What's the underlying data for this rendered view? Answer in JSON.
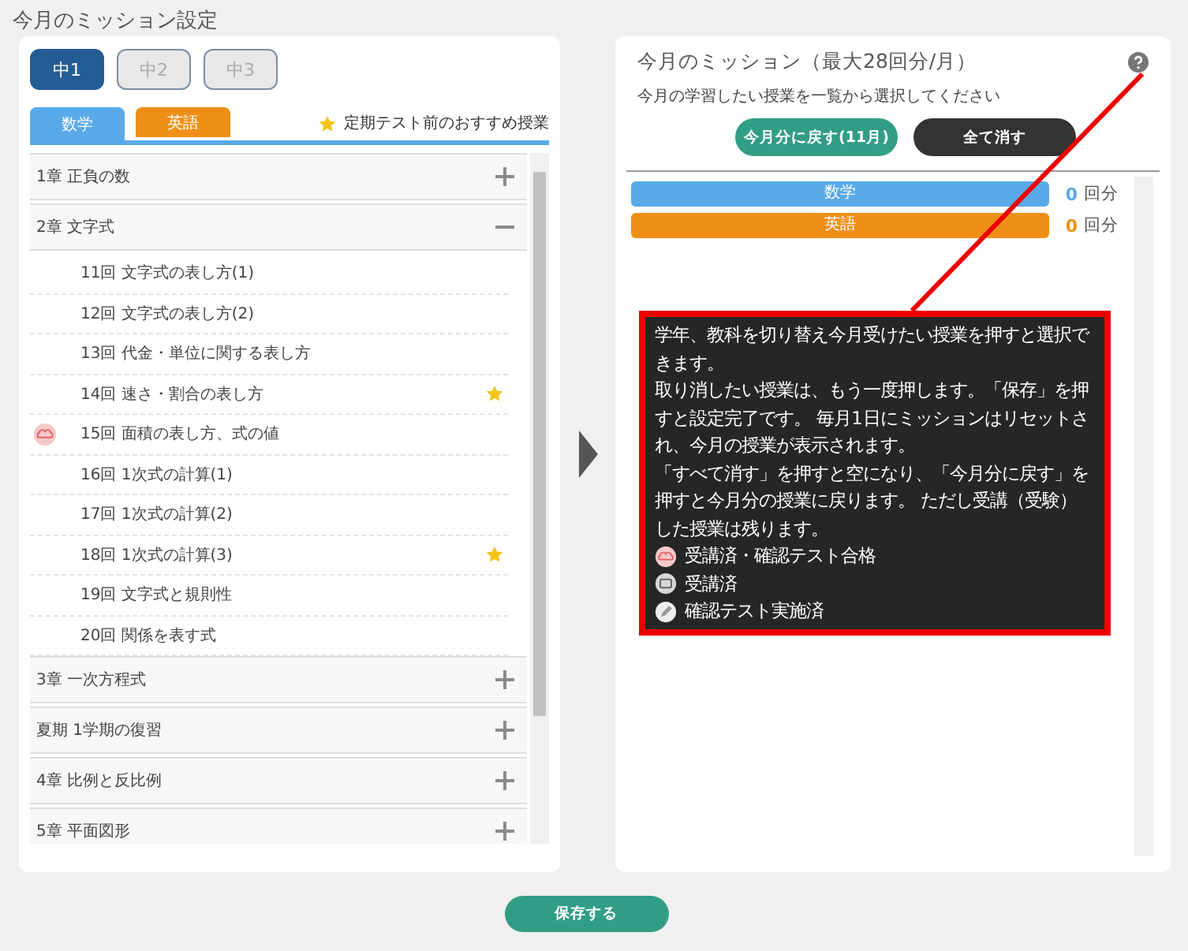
{
  "page_title": "今月のミッション設定",
  "grades": [
    {
      "label": "中1",
      "selected": true
    },
    {
      "label": "中2",
      "selected": false
    },
    {
      "label": "中3",
      "selected": false
    }
  ],
  "subject_tabs": [
    {
      "label": "数学",
      "color": "#5aaaea",
      "selected": true
    },
    {
      "label": "英語",
      "color": "#ee9018",
      "selected": false
    }
  ],
  "recommend_note": "定期テスト前のおすすめ授業",
  "chapters": [
    {
      "label": "1章 正負の数",
      "expanded": false
    },
    {
      "label": "2章 文字式",
      "expanded": true,
      "children": [
        {
          "label": "11回 文字式の表し方(1)",
          "recommended": false,
          "passed": false
        },
        {
          "label": "12回 文字式の表し方(2)",
          "recommended": false,
          "passed": false
        },
        {
          "label": "13回 代金・単位に関する表し方",
          "recommended": false,
          "passed": false
        },
        {
          "label": "14回 速さ・割合の表し方",
          "recommended": true,
          "passed": false
        },
        {
          "label": "15回 面積の表し方、式の値",
          "recommended": false,
          "passed": true
        },
        {
          "label": "16回 1次式の計算(1)",
          "recommended": false,
          "passed": false
        },
        {
          "label": "17回 1次式の計算(2)",
          "recommended": false,
          "passed": false
        },
        {
          "label": "18回 1次式の計算(3)",
          "recommended": true,
          "passed": false
        },
        {
          "label": "19回 文字式と規則性",
          "recommended": false,
          "passed": false
        },
        {
          "label": "20回 関係を表す式",
          "recommended": false,
          "passed": false
        }
      ]
    },
    {
      "label": "3章 一次方程式",
      "expanded": false
    },
    {
      "label": "夏期 1学期の復習",
      "expanded": false
    },
    {
      "label": "4章 比例と反比例",
      "expanded": false
    },
    {
      "label": "5章 平面図形",
      "expanded": false
    }
  ],
  "mission": {
    "title": "今月のミッション（最大28回分/月）",
    "subtitle": "今月の学習したい授業を一覧から選択してください",
    "buttons": [
      {
        "label": "今月分に戻す(11月)",
        "kind": "primary"
      },
      {
        "label": "全て消す",
        "kind": "dark"
      }
    ],
    "subjects": [
      {
        "label": "数学",
        "color": "#5aaaea",
        "count": "0",
        "unit": "回分"
      },
      {
        "label": "英語",
        "color": "#ee9018",
        "count": "0",
        "unit": "回分"
      }
    ]
  },
  "help_popup": {
    "paragraphs": [
      "学年、教科を切り替え今月受けたい授業を押すと選択できます。",
      "取り消したい授業は、もう一度押します。「保存」を押すと設定完了です。 毎月1日にミッションはリセットされ、今月の授業が表示されます。",
      "「すべて消す」を押すと空になり、「今月分に戻す」を押すと今月分の授業に戻ります。 ただし受講（受験）した授業は残ります。"
    ],
    "legend": [
      {
        "kind": "passed",
        "label": "受講済・確認テスト合格"
      },
      {
        "kind": "attended",
        "label": "受講済"
      },
      {
        "kind": "tested",
        "label": "確認テスト実施済"
      }
    ]
  },
  "save_button": "保存する"
}
